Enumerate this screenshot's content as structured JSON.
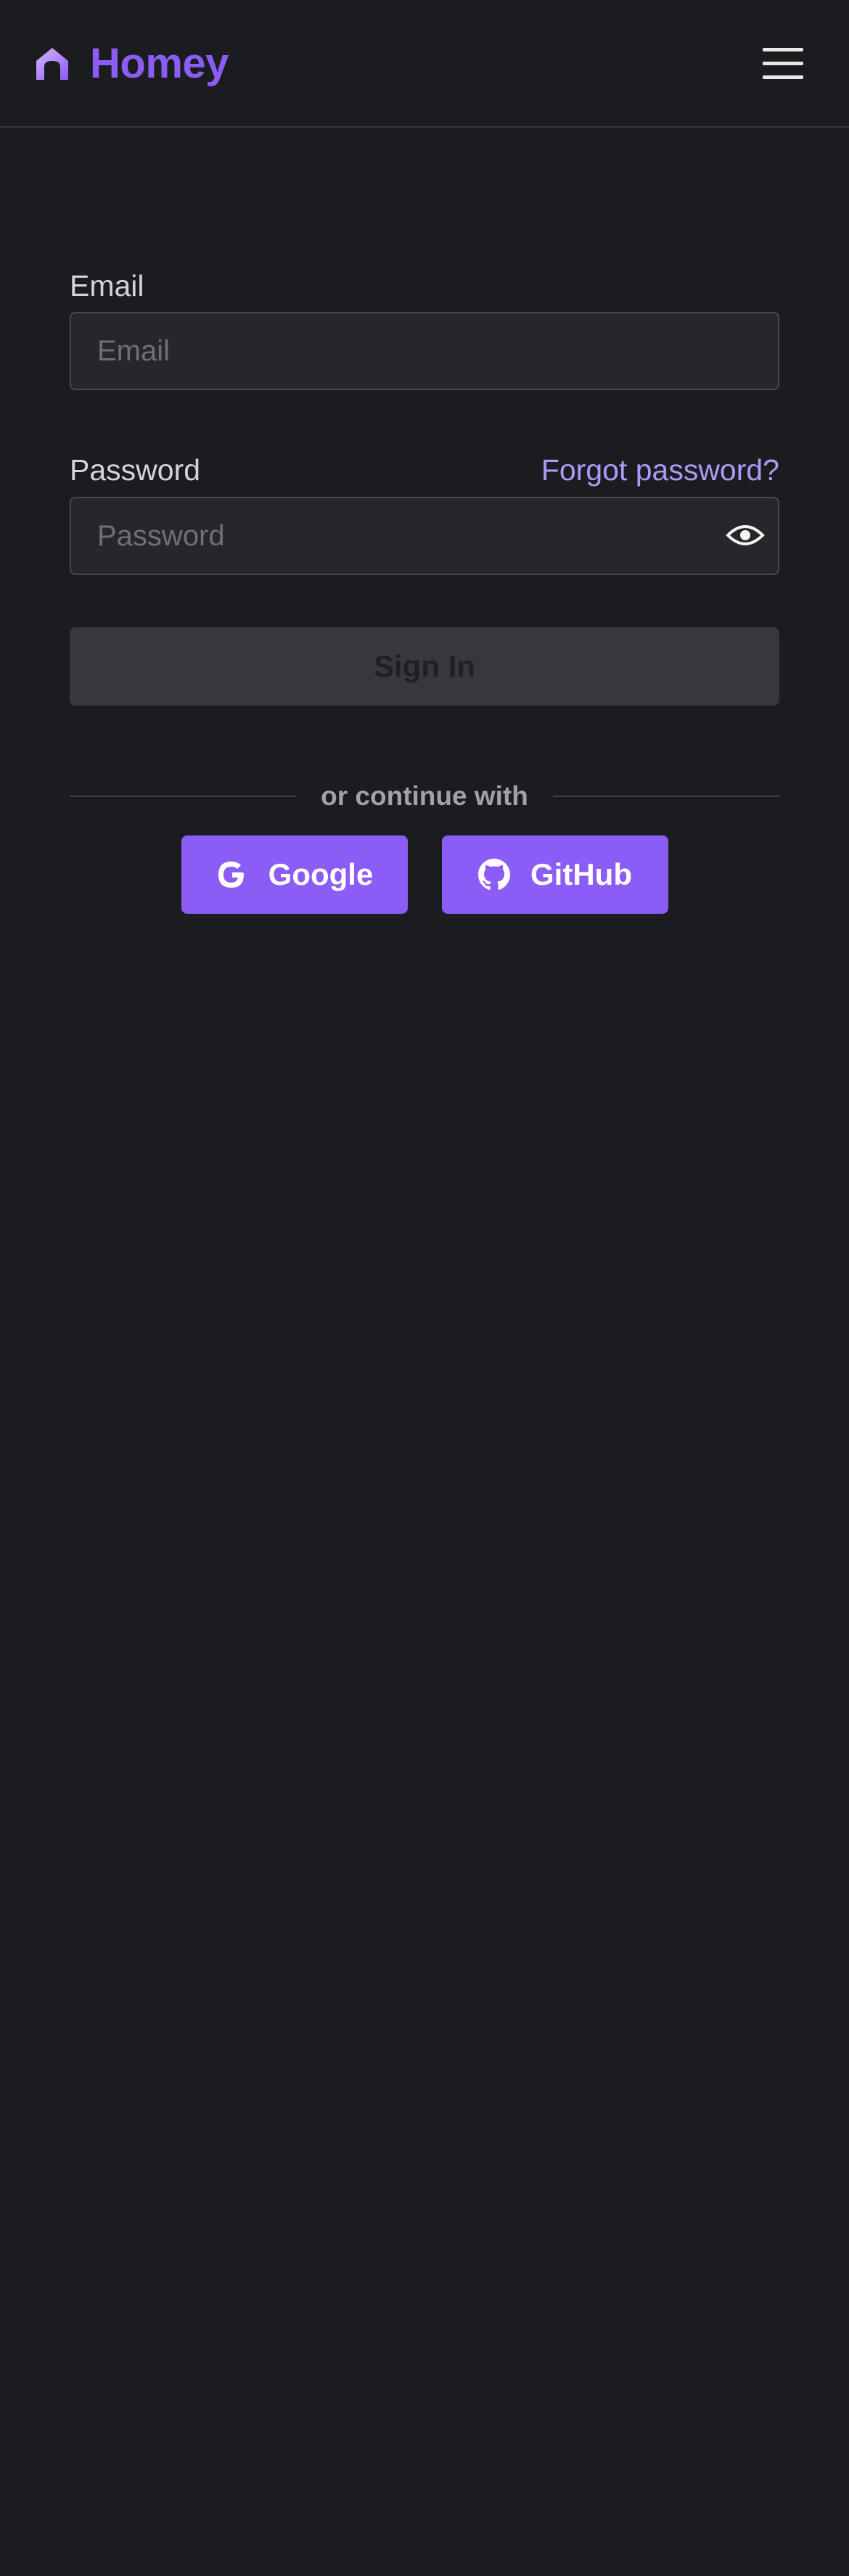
{
  "header": {
    "brand_name": "Homey",
    "logo_icon": "house-arch-icon",
    "menu_icon": "hamburger-menu-icon"
  },
  "form": {
    "email_label": "Email",
    "email_placeholder": "Email",
    "email_value": "",
    "password_label": "Password",
    "password_placeholder": "Password",
    "password_value": "",
    "forgot_password": "Forgot password?",
    "show_password_icon": "eye-icon",
    "sign_in_label": "Sign In",
    "sign_in_enabled": false
  },
  "social": {
    "divider_text": "or continue with",
    "providers": [
      {
        "label": "Google",
        "icon": "google-icon"
      },
      {
        "label": "GitHub",
        "icon": "github-icon"
      }
    ]
  },
  "colors": {
    "background": "#1b1c1f",
    "accent": "#8b5cf6",
    "link": "#a79cf8",
    "input_background": "#26272b",
    "input_border": "#48494e",
    "disabled_button": "#37383d"
  }
}
